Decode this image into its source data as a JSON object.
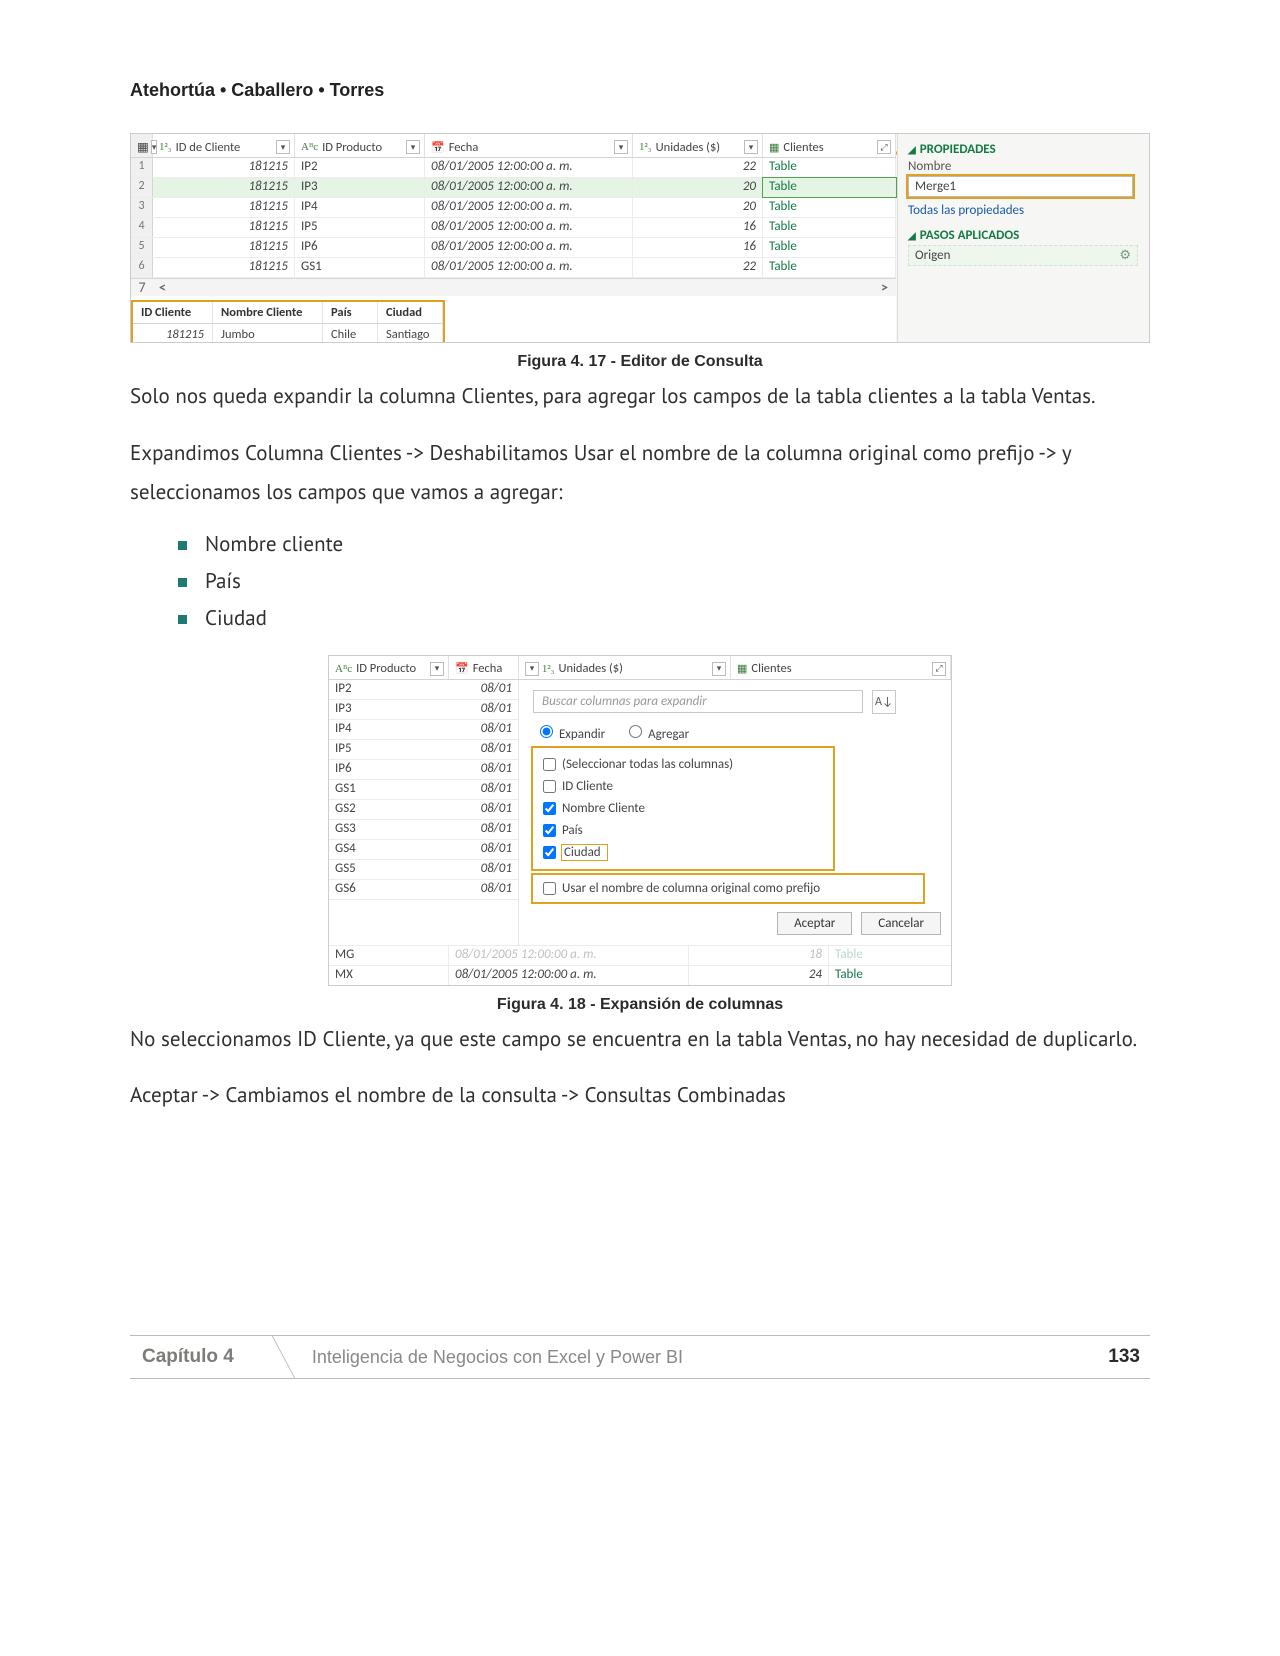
{
  "runningHead": "Atehortúa • Caballero • Torres",
  "fig17": {
    "cols": {
      "id": "ID de Cliente",
      "prod": "ID Producto",
      "fecha": "Fecha",
      "uni": "Unidades ($)",
      "cli": "Clientes"
    },
    "rows": [
      {
        "n": "1",
        "id": "181215",
        "prod": "IP2",
        "fecha": "08/01/2005 12:00:00 a. m.",
        "uni": "22",
        "cli": "Table"
      },
      {
        "n": "2",
        "id": "181215",
        "prod": "IP3",
        "fecha": "08/01/2005 12:00:00 a. m.",
        "uni": "20",
        "cli": "Table"
      },
      {
        "n": "3",
        "id": "181215",
        "prod": "IP4",
        "fecha": "08/01/2005 12:00:00 a. m.",
        "uni": "20",
        "cli": "Table"
      },
      {
        "n": "4",
        "id": "181215",
        "prod": "IP5",
        "fecha": "08/01/2005 12:00:00 a. m.",
        "uni": "16",
        "cli": "Table"
      },
      {
        "n": "5",
        "id": "181215",
        "prod": "IP6",
        "fecha": "08/01/2005 12:00:00 a. m.",
        "uni": "16",
        "cli": "Table"
      },
      {
        "n": "6",
        "id": "181215",
        "prod": "GS1",
        "fecha": "08/01/2005 12:00:00 a. m.",
        "uni": "22",
        "cli": "Table"
      }
    ],
    "row7": "7",
    "detail": {
      "h": {
        "id": "ID Cliente",
        "nom": "Nombre  Cliente",
        "pais": "País",
        "ciu": "Ciudad"
      },
      "r": {
        "id": "181215",
        "nom": "Jumbo",
        "pais": "Chile",
        "ciu": "Santiago"
      }
    },
    "right": {
      "prop": "PROPIEDADES",
      "nombre": "Nombre",
      "merge": "Merge1",
      "todas": "Todas las propiedades",
      "pasos": "PASOS APLICADOS",
      "origen": "Origen"
    },
    "caption": "Figura 4. 17 -  Editor de Consulta"
  },
  "para1": "Solo nos queda expandir la columna Clientes, para agregar los campos de la tabla clientes a la tabla Ventas.",
  "para2": "Expandimos Columna Clientes -> Deshabilitamos Usar el nombre de la columna original como prefijo -> y seleccionamos los campos que vamos a agregar:",
  "list": {
    "a": "Nombre cliente",
    "b": "País",
    "c": "Ciudad"
  },
  "fig18": {
    "cols": {
      "prod": "ID Producto",
      "fecha": "Fecha",
      "uni": "Unidades ($)",
      "cli": "Clientes"
    },
    "leftRows": [
      {
        "p": "IP2",
        "f": "08/01"
      },
      {
        "p": "IP3",
        "f": "08/01"
      },
      {
        "p": "IP4",
        "f": "08/01"
      },
      {
        "p": "IP5",
        "f": "08/01"
      },
      {
        "p": "IP6",
        "f": "08/01"
      },
      {
        "p": "GS1",
        "f": "08/01"
      },
      {
        "p": "GS2",
        "f": "08/01"
      },
      {
        "p": "GS3",
        "f": "08/01"
      },
      {
        "p": "GS4",
        "f": "08/01"
      },
      {
        "p": "GS5",
        "f": "08/01"
      },
      {
        "p": "GS6",
        "f": "08/01"
      }
    ],
    "search": "Buscar columnas para expandir",
    "expandir": "Expandir",
    "agregar": "Agregar",
    "selAll": "(Seleccionar todas las columnas)",
    "c1": "ID Cliente",
    "c2": "Nombre Cliente",
    "c3": "País",
    "c4": "Ciudad",
    "prefix": "Usar el nombre de columna original como prefijo",
    "ok": "Aceptar",
    "cancel": "Cancelar",
    "btm": [
      {
        "p": "MG",
        "f": "08/01/2005 12:00:00 a. m.",
        "u": "18",
        "c": "Table"
      },
      {
        "p": "MX",
        "f": "08/01/2005 12:00:00 a. m.",
        "u": "24",
        "c": "Table"
      }
    ],
    "caption": "Figura 4. 18 -  Expansión de columnas"
  },
  "para3": "No seleccionamos ID Cliente, ya que este campo se encuentra en la tabla Ventas, no hay necesidad de duplicarlo.",
  "para4": "Aceptar -> Cambiamos el nombre de la consulta -> Consultas Combinadas",
  "footer": {
    "chap": "Capítulo 4",
    "title": "Inteligencia de Negocios con Excel y Power BI",
    "page": "133"
  }
}
